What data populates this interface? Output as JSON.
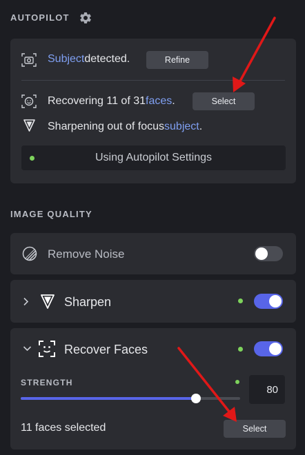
{
  "autopilot": {
    "title": "AUTOPILOT",
    "subject_highlight": "Subject",
    "subject_rest": " detected.",
    "refine_label": "Refine",
    "faces_prefix": "Recovering 11 of 31 ",
    "faces_highlight": "faces",
    "faces_suffix": ".",
    "faces_select_label": "Select",
    "sharpen_prefix": "Sharpening out of focus ",
    "sharpen_highlight": "subject",
    "sharpen_suffix": ".",
    "status_text": "Using Autopilot Settings"
  },
  "image_quality": {
    "title": "IMAGE QUALITY",
    "remove_noise": {
      "label": "Remove Noise",
      "enabled": false
    },
    "sharpen": {
      "label": "Sharpen",
      "enabled": true
    },
    "recover_faces": {
      "label": "Recover Faces",
      "enabled": true,
      "strength_label": "STRENGTH",
      "strength_value": "80",
      "strength_fraction": 0.8,
      "faces_selected_text": "11 faces selected",
      "select_label": "Select"
    }
  },
  "colors": {
    "accent": "#5865e8",
    "highlight_text": "#7f9ff1",
    "status_dot": "#7ed35c",
    "annotation_arrow": "#e01818"
  },
  "icons": [
    "gear-icon",
    "camera-focus-icon",
    "face-icon",
    "sharpen-triangle-icon",
    "noise-icon",
    "chevron-right-icon",
    "chevron-down-icon",
    "face-frame-icon"
  ]
}
